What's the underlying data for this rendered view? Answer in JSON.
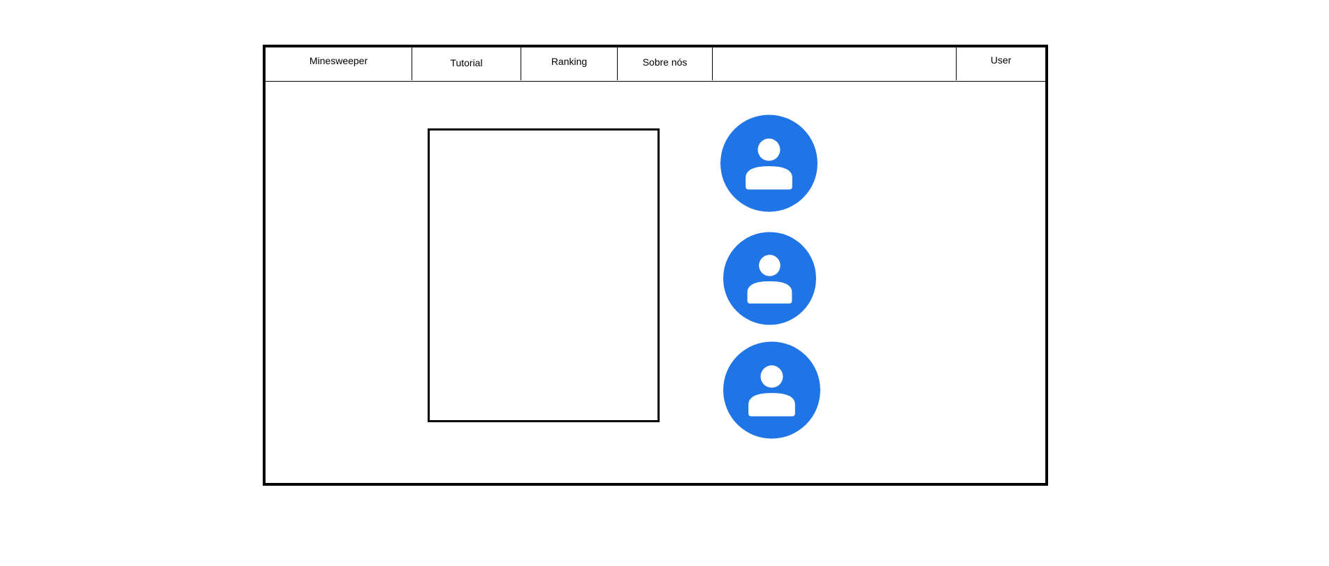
{
  "nav": {
    "brand": "Minesweeper",
    "items": [
      {
        "label": "Tutorial"
      },
      {
        "label": "Ranking"
      },
      {
        "label": "Sobre nós"
      }
    ],
    "user": "User"
  },
  "avatars": [
    {
      "icon": "person-icon"
    },
    {
      "icon": "person-icon"
    },
    {
      "icon": "person-icon"
    }
  ],
  "colors": {
    "avatar_blue": "#1f74e6",
    "frame_border": "#000000",
    "background": "#ffffff"
  }
}
